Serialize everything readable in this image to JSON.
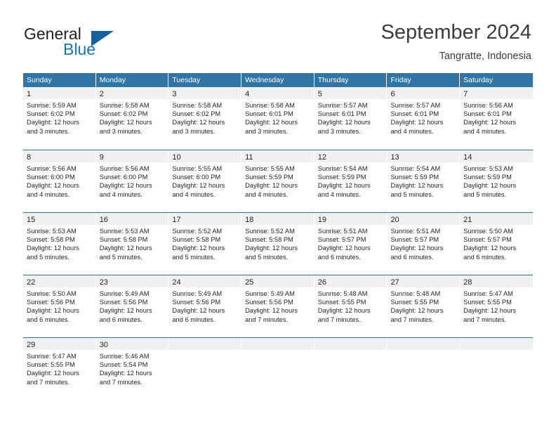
{
  "brand": {
    "word_one": "General",
    "word_two": "Blue",
    "triangle_icon": "triangle-icon"
  },
  "header": {
    "title": "September 2024",
    "subtitle": "Tangratte, Indonesia"
  },
  "theme": {
    "header_blue": "#3174a6",
    "rule_blue": "#2f6fa3",
    "day_band_gray": "#f0f0f0",
    "brand_blue": "#1277bc",
    "text": "#231f20"
  },
  "weekdays": [
    "Sunday",
    "Monday",
    "Tuesday",
    "Wednesday",
    "Thursday",
    "Friday",
    "Saturday"
  ],
  "weeks": [
    [
      {
        "day": "1",
        "sunrise": "Sunrise: 5:59 AM",
        "sunset": "Sunset: 6:02 PM",
        "daylight1": "Daylight: 12 hours",
        "daylight2": "and 3 minutes."
      },
      {
        "day": "2",
        "sunrise": "Sunrise: 5:58 AM",
        "sunset": "Sunset: 6:02 PM",
        "daylight1": "Daylight: 12 hours",
        "daylight2": "and 3 minutes."
      },
      {
        "day": "3",
        "sunrise": "Sunrise: 5:58 AM",
        "sunset": "Sunset: 6:02 PM",
        "daylight1": "Daylight: 12 hours",
        "daylight2": "and 3 minutes."
      },
      {
        "day": "4",
        "sunrise": "Sunrise: 5:58 AM",
        "sunset": "Sunset: 6:01 PM",
        "daylight1": "Daylight: 12 hours",
        "daylight2": "and 3 minutes."
      },
      {
        "day": "5",
        "sunrise": "Sunrise: 5:57 AM",
        "sunset": "Sunset: 6:01 PM",
        "daylight1": "Daylight: 12 hours",
        "daylight2": "and 3 minutes."
      },
      {
        "day": "6",
        "sunrise": "Sunrise: 5:57 AM",
        "sunset": "Sunset: 6:01 PM",
        "daylight1": "Daylight: 12 hours",
        "daylight2": "and 4 minutes."
      },
      {
        "day": "7",
        "sunrise": "Sunrise: 5:56 AM",
        "sunset": "Sunset: 6:01 PM",
        "daylight1": "Daylight: 12 hours",
        "daylight2": "and 4 minutes."
      }
    ],
    [
      {
        "day": "8",
        "sunrise": "Sunrise: 5:56 AM",
        "sunset": "Sunset: 6:00 PM",
        "daylight1": "Daylight: 12 hours",
        "daylight2": "and 4 minutes."
      },
      {
        "day": "9",
        "sunrise": "Sunrise: 5:56 AM",
        "sunset": "Sunset: 6:00 PM",
        "daylight1": "Daylight: 12 hours",
        "daylight2": "and 4 minutes."
      },
      {
        "day": "10",
        "sunrise": "Sunrise: 5:55 AM",
        "sunset": "Sunset: 6:00 PM",
        "daylight1": "Daylight: 12 hours",
        "daylight2": "and 4 minutes."
      },
      {
        "day": "11",
        "sunrise": "Sunrise: 5:55 AM",
        "sunset": "Sunset: 5:59 PM",
        "daylight1": "Daylight: 12 hours",
        "daylight2": "and 4 minutes."
      },
      {
        "day": "12",
        "sunrise": "Sunrise: 5:54 AM",
        "sunset": "Sunset: 5:59 PM",
        "daylight1": "Daylight: 12 hours",
        "daylight2": "and 4 minutes."
      },
      {
        "day": "13",
        "sunrise": "Sunrise: 5:54 AM",
        "sunset": "Sunset: 5:59 PM",
        "daylight1": "Daylight: 12 hours",
        "daylight2": "and 5 minutes."
      },
      {
        "day": "14",
        "sunrise": "Sunrise: 5:53 AM",
        "sunset": "Sunset: 5:59 PM",
        "daylight1": "Daylight: 12 hours",
        "daylight2": "and 5 minutes."
      }
    ],
    [
      {
        "day": "15",
        "sunrise": "Sunrise: 5:53 AM",
        "sunset": "Sunset: 5:58 PM",
        "daylight1": "Daylight: 12 hours",
        "daylight2": "and 5 minutes."
      },
      {
        "day": "16",
        "sunrise": "Sunrise: 5:53 AM",
        "sunset": "Sunset: 5:58 PM",
        "daylight1": "Daylight: 12 hours",
        "daylight2": "and 5 minutes."
      },
      {
        "day": "17",
        "sunrise": "Sunrise: 5:52 AM",
        "sunset": "Sunset: 5:58 PM",
        "daylight1": "Daylight: 12 hours",
        "daylight2": "and 5 minutes."
      },
      {
        "day": "18",
        "sunrise": "Sunrise: 5:52 AM",
        "sunset": "Sunset: 5:58 PM",
        "daylight1": "Daylight: 12 hours",
        "daylight2": "and 5 minutes."
      },
      {
        "day": "19",
        "sunrise": "Sunrise: 5:51 AM",
        "sunset": "Sunset: 5:57 PM",
        "daylight1": "Daylight: 12 hours",
        "daylight2": "and 6 minutes."
      },
      {
        "day": "20",
        "sunrise": "Sunrise: 5:51 AM",
        "sunset": "Sunset: 5:57 PM",
        "daylight1": "Daylight: 12 hours",
        "daylight2": "and 6 minutes."
      },
      {
        "day": "21",
        "sunrise": "Sunrise: 5:50 AM",
        "sunset": "Sunset: 5:57 PM",
        "daylight1": "Daylight: 12 hours",
        "daylight2": "and 6 minutes."
      }
    ],
    [
      {
        "day": "22",
        "sunrise": "Sunrise: 5:50 AM",
        "sunset": "Sunset: 5:56 PM",
        "daylight1": "Daylight: 12 hours",
        "daylight2": "and 6 minutes."
      },
      {
        "day": "23",
        "sunrise": "Sunrise: 5:49 AM",
        "sunset": "Sunset: 5:56 PM",
        "daylight1": "Daylight: 12 hours",
        "daylight2": "and 6 minutes."
      },
      {
        "day": "24",
        "sunrise": "Sunrise: 5:49 AM",
        "sunset": "Sunset: 5:56 PM",
        "daylight1": "Daylight: 12 hours",
        "daylight2": "and 6 minutes."
      },
      {
        "day": "25",
        "sunrise": "Sunrise: 5:49 AM",
        "sunset": "Sunset: 5:56 PM",
        "daylight1": "Daylight: 12 hours",
        "daylight2": "and 7 minutes."
      },
      {
        "day": "26",
        "sunrise": "Sunrise: 5:48 AM",
        "sunset": "Sunset: 5:55 PM",
        "daylight1": "Daylight: 12 hours",
        "daylight2": "and 7 minutes."
      },
      {
        "day": "27",
        "sunrise": "Sunrise: 5:48 AM",
        "sunset": "Sunset: 5:55 PM",
        "daylight1": "Daylight: 12 hours",
        "daylight2": "and 7 minutes."
      },
      {
        "day": "28",
        "sunrise": "Sunrise: 5:47 AM",
        "sunset": "Sunset: 5:55 PM",
        "daylight1": "Daylight: 12 hours",
        "daylight2": "and 7 minutes."
      }
    ],
    [
      {
        "day": "29",
        "sunrise": "Sunrise: 5:47 AM",
        "sunset": "Sunset: 5:55 PM",
        "daylight1": "Daylight: 12 hours",
        "daylight2": "and 7 minutes."
      },
      {
        "day": "30",
        "sunrise": "Sunrise: 5:46 AM",
        "sunset": "Sunset: 5:54 PM",
        "daylight1": "Daylight: 12 hours",
        "daylight2": "and 7 minutes."
      },
      {
        "day": "",
        "sunrise": "",
        "sunset": "",
        "daylight1": "",
        "daylight2": ""
      },
      {
        "day": "",
        "sunrise": "",
        "sunset": "",
        "daylight1": "",
        "daylight2": ""
      },
      {
        "day": "",
        "sunrise": "",
        "sunset": "",
        "daylight1": "",
        "daylight2": ""
      },
      {
        "day": "",
        "sunrise": "",
        "sunset": "",
        "daylight1": "",
        "daylight2": ""
      },
      {
        "day": "",
        "sunrise": "",
        "sunset": "",
        "daylight1": "",
        "daylight2": ""
      }
    ]
  ]
}
